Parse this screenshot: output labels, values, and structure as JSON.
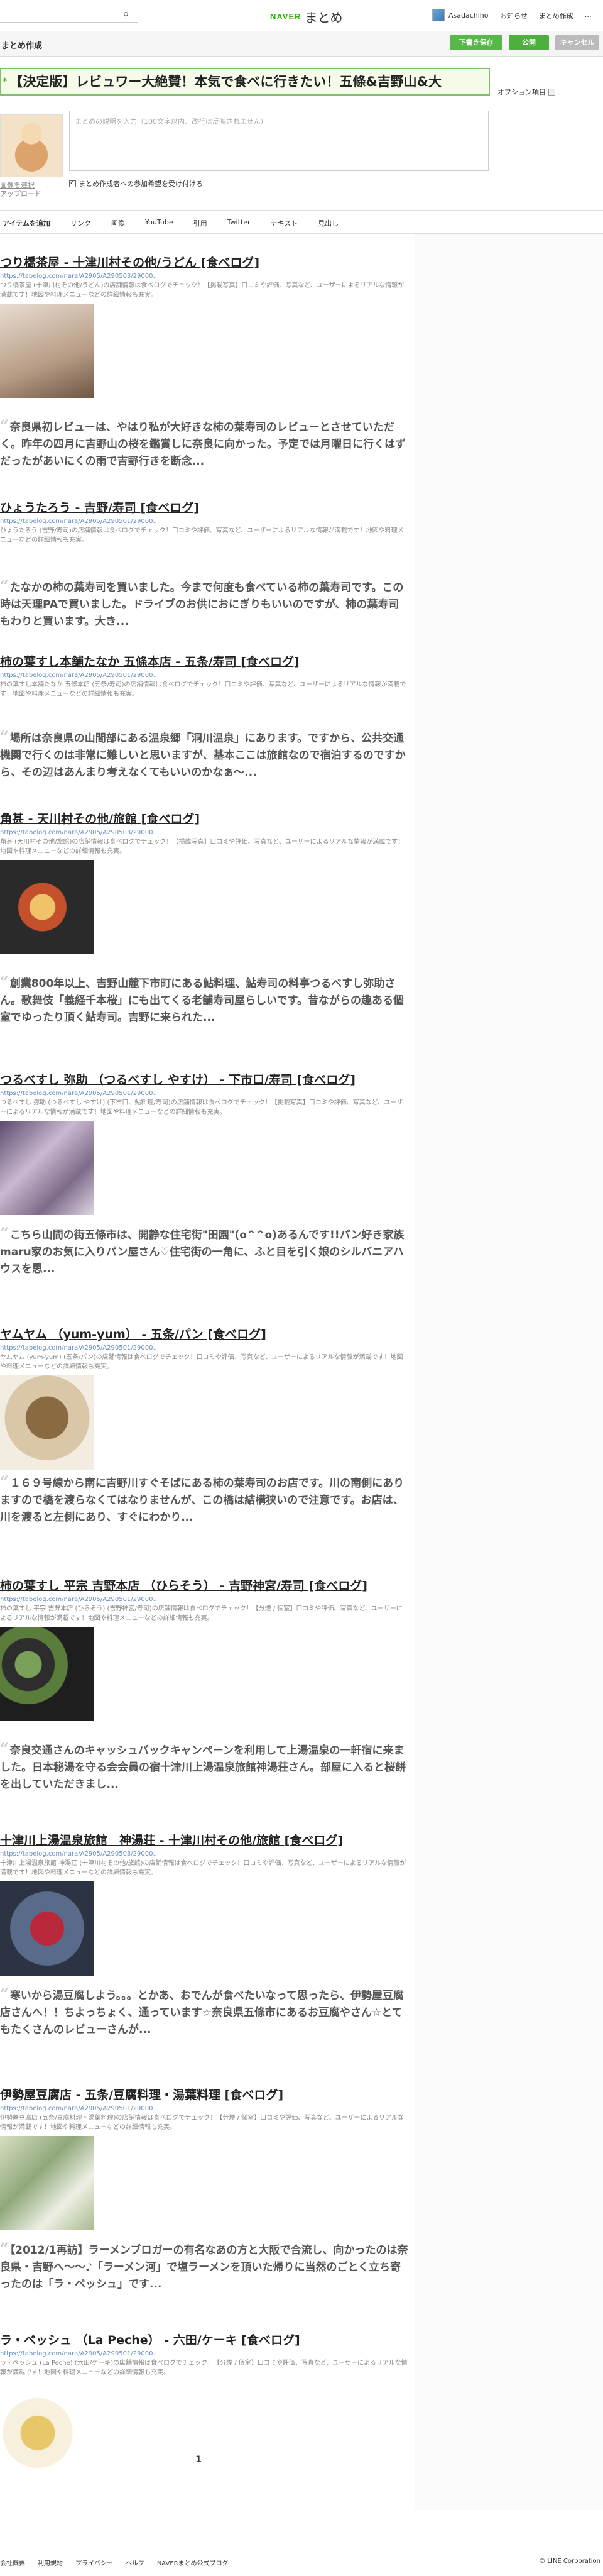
{
  "header": {
    "search_btn_icon": "search-icon",
    "logo_naver": "NAVER",
    "logo_matome": "まとめ",
    "user_name": "Asadachiho",
    "links": [
      "お知らせ",
      "まとめ作成",
      "…"
    ]
  },
  "subheader": {
    "title": "まとめ作成",
    "draft_label": "下書き保存",
    "publish_label": "公開",
    "cancel_label": "キャンセル"
  },
  "editor": {
    "title_value": "【決定版】レビュワー大絶賛！本気で食べに行きたい！五條&吉野山&大",
    "option_label": "オプション項目",
    "thumb_links": [
      "画像を選択",
      "アップロード"
    ],
    "desc_placeholder": "まとめの説明を入力（100文字以内、改行は反映されません）",
    "comment_label": "まとめ作成者への参加希望を受け付ける"
  },
  "toolbar": {
    "items": [
      "アイテムを追加",
      "リンク",
      "画像",
      "YouTube",
      "引用",
      "Twitter",
      "テキスト",
      "見出し"
    ]
  },
  "items": [
    {
      "kind": "link",
      "title": "つり橋茶屋 - 十津川村その他/うどん [食べログ]",
      "url": "https://tabelog.com/nara/A2905/A290503/29000...",
      "desc": "つり橋茶屋 (十津川村その他/うどん)の店舗情報は食べログでチェック！【掲載写真】口コミや評価、写真など、ユーザーによるリアルな情報が満載です！地図や料理メニューなどの詳細情報も充実。"
    },
    {
      "kind": "quote",
      "text": "奈良県初レビューは、やはり私が大好きな柿の葉寿司のレビューとさせていただく。昨年の四月に吉野山の桜を鑑賞しに奈良に向かった。予定では月曜日に行くはずだったがあいにくの雨で吉野行きを断念..."
    },
    {
      "kind": "link",
      "title": "ひょうたろう - 吉野/寿司 [食べログ]",
      "url": "https://tabelog.com/nara/A2905/A290501/29000...",
      "desc": "ひょうたろう (吉野/寿司)の店舗情報は食べログでチェック！口コミや評価、写真など、ユーザーによるリアルな情報が満載です！地図や料理メニューなどの詳細情報も充実。"
    },
    {
      "kind": "quote",
      "text": "たなかの柿の葉寿司を買いました。今まで何度も食べている柿の葉寿司です。この時は天理PAで買いました。ドライブのお供におにぎりもいいのですが、柿の葉寿司もわりと買います。大き..."
    },
    {
      "kind": "link",
      "title": "柿の葉すし本舗たなか 五條本店 - 五条/寿司 [食べログ]",
      "url": "https://tabelog.com/nara/A2905/A290501/29000...",
      "desc": "柿の葉すし本舗たなか 五條本店 (五条/寿司)の店舗情報は食べログでチェック！口コミや評価、写真など、ユーザーによるリアルな情報が満載です！地図や料理メニューなどの詳細情報も充実。"
    },
    {
      "kind": "quote",
      "text": "場所は奈良県の山間部にある温泉郷「洞川温泉」にあります。ですから、公共交通機関で行くのは非常に難しいと思いますが、基本ここは旅館なので宿泊するのですから、その辺はあんまり考えなくてもいいのかなぁ～..."
    },
    {
      "kind": "link",
      "title": "角甚 - 天川村その他/旅館 [食べログ]",
      "url": "https://tabelog.com/nara/A2905/A290503/29000...",
      "desc": "角甚 (天川村その他/旅館)の店舗情報は食べログでチェック！【掲載写真】口コミや評価、写真など、ユーザーによるリアルな情報が満載です！地図や料理メニューなどの詳細情報も充実。"
    },
    {
      "kind": "quote",
      "text": "創業800年以上、吉野山麓下市町にある鮎料理、鮎寿司の料亭つるべすし弥助さん。歌舞伎「義経千本桜」にも出てくる老舗寿司屋らしいです。昔ながらの趣ある個室でゆったり頂く鮎寿司。吉野に来られた..."
    },
    {
      "kind": "link",
      "title": "つるべすし 弥助 （つるべすし やすけ） - 下市口/寿司 [食べログ]",
      "url": "https://tabelog.com/nara/A2905/A290501/29000...",
      "desc": "つるべすし 弥助 (つるべすし やすけ) (下市口、鮎料理/寿司)の店舗情報は食べログでチェック！【掲載写真】口コミや評価、写真など、ユーザーによるリアルな情報が満載です！地図や料理メニューなどの詳細情報も充実。"
    },
    {
      "kind": "quote",
      "text": "こちら山間の街五條市は、開静な住宅街\"田園\"(o^^o)あるんです!!パン好き家族maru家のお気に入りパン屋さん♡住宅街の一角に、ふと目を引く娘のシルバニアハウスを思..."
    },
    {
      "kind": "link",
      "title": "ヤムヤム （yum-yum） - 五条/パン [食べログ]",
      "url": "https://tabelog.com/nara/A2905/A290501/29000...",
      "desc": "ヤムヤム (yum-yum) (五条/パン)の店舗情報は食べログでチェック！口コミや評価、写真など、ユーザーによるリアルな情報が満載です！地図や料理メニューなどの詳細情報も充実。"
    },
    {
      "kind": "quote",
      "text": "１６９号線から南に吉野川すぐそばにある柿の葉寿司のお店です。川の南側にありますので橋を渡らなくてはなりませんが、この橋は結構狭いので注意です。お店は、川を渡ると左側にあり、すぐにわかり..."
    },
    {
      "kind": "link",
      "title": "柿の葉すし 平宗 吉野本店 （ひらそう） - 吉野神宮/寿司 [食べログ]",
      "url": "https://tabelog.com/nara/A2905/A290501/29000...",
      "desc": "柿の葉すし 平宗 吉野本店 (ひらそう) (吉野神宮/寿司)の店舗情報は食べログでチェック！【分煙 / 個室】口コミや評価、写真など、ユーザーによるリアルな情報が満載です！地図や料理メニューなどの詳細情報も充実。"
    },
    {
      "kind": "quote",
      "text": "奈良交通さんのキャッシュバックキャンペーンを利用して上湯温泉の一軒宿に来ました。日本秘湯を守る会会員の宿十津川上湯温泉旅館神湯荘さん。部屋に入ると桜餅を出していただきまし..."
    },
    {
      "kind": "link",
      "title": "十津川上湯温泉旅館　神湯荘 - 十津川村その他/旅館 [食べログ]",
      "url": "https://tabelog.com/nara/A2905/A290503/29000...",
      "desc": "十津川上湯温泉旅館 神湯荘 (十津川村その他/旅館)の店舗情報は食べログでチェック！口コミや評価、写真など、ユーザーによるリアルな情報が満載です！地図や料理メニューなどの詳細情報も充実。"
    },
    {
      "kind": "quote",
      "text": "寒いから湯豆腐しよう。。。とかあ、おでんが食べたいなって思ったら、伊勢屋豆腐店さんへ！！ちよっちょく、通っています☆奈良県五條市にあるお豆腐やさん☆とてもたくさんのレビューさんが..."
    },
    {
      "kind": "link",
      "title": "伊勢屋豆腐店 - 五条/豆腐料理・湯葉料理 [食べログ]",
      "url": "https://tabelog.com/nara/A2905/A290501/29000...",
      "desc": "伊勢屋豆腐店 (五条/豆腐料理・湯葉料理)の店舗情報は食べログでチェック！【分煙 / 個室】口コミや評価、写真など、ユーザーによるリアルな情報が満載です！地図や料理メニューなどの詳細情報も充実。"
    },
    {
      "kind": "quote",
      "text": "【2012/1再訪】ラーメンブロガーの有名なあの方と大阪で合流し、向かったのは奈良県・吉野へ～～♪「ラーメン河」で塩ラーメンを頂いた帰りに当然のごとく立ち寄ったのは「ラ・ペッシュ」です..."
    },
    {
      "kind": "link",
      "title": "ラ・ペッシュ （La Peche） - 六田/ケーキ [食べログ]",
      "url": "https://tabelog.com/nara/A2905/A290501/29000...",
      "desc": "ラ・ペッシュ (La Peche) (六田/ケーキ)の店舗情報は食べログでチェック！【分煙 / 個室】口コミや評価、写真など、ユーザーによるリアルな情報が満載です！地図や料理メニューなどの詳細情報も充実。"
    }
  ],
  "pager": {
    "current": "1"
  },
  "footer": {
    "links": [
      "会社概要",
      "利用規約",
      "プライバシー",
      "ヘルプ",
      "NAVERまとめ公式ブログ"
    ],
    "copyright": "© LINE Corporation"
  },
  "colors": {
    "accent": "#4caf3e",
    "link": "#6a8dbf",
    "cancel": "#bbbbbb"
  }
}
